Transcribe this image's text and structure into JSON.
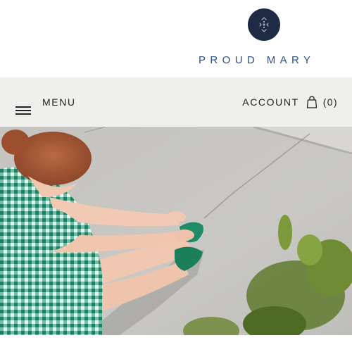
{
  "brand": {
    "name": "PROUD MARY",
    "logo_icon": "proud-mary-logo-icon",
    "logo_color": "#1f2a44",
    "wordmark_color": "#2d4f8a"
  },
  "nav": {
    "menu_label": "MENU",
    "menu_icon": "hamburger-icon",
    "account_label": "ACCOUNT",
    "bag_icon": "shopping-bag-icon",
    "cart_count": "(0)",
    "background": "#efefed"
  },
  "hero": {
    "image": "woman-in-green-gingham-dress-sitting-on-pavement-touching-green-shoes"
  }
}
